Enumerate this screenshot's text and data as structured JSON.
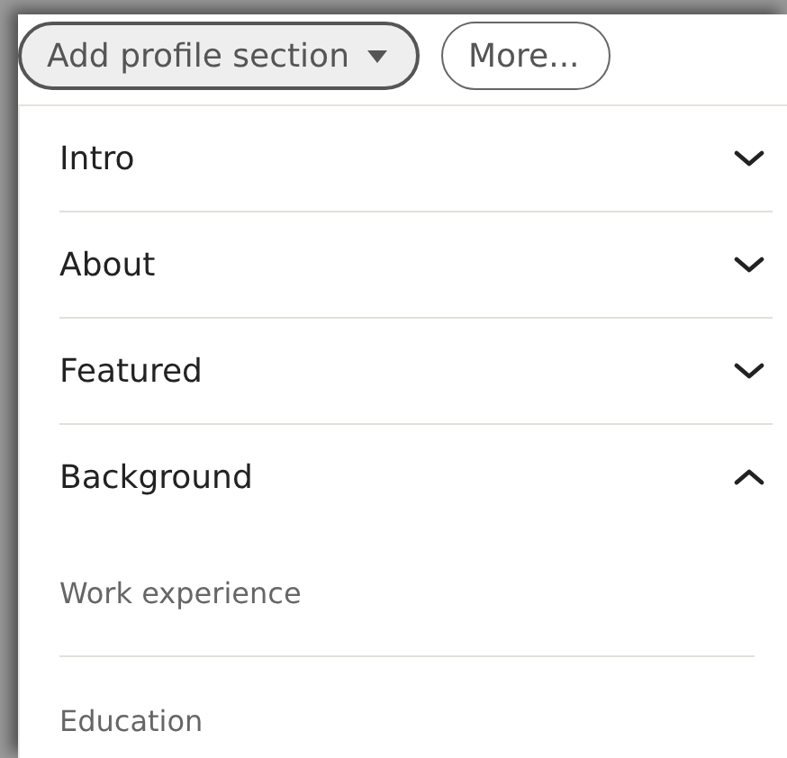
{
  "buttons": [
    {
      "label": "Add profile section",
      "kind": "dropdown"
    },
    {
      "label": "More...",
      "kind": "plain"
    }
  ],
  "sections": [
    {
      "label": "Intro",
      "expanded": false
    },
    {
      "label": "About",
      "expanded": false
    },
    {
      "label": "Featured",
      "expanded": false
    },
    {
      "label": "Background",
      "expanded": true,
      "children": [
        {
          "label": "Work experience"
        },
        {
          "label": "Education"
        }
      ]
    }
  ]
}
